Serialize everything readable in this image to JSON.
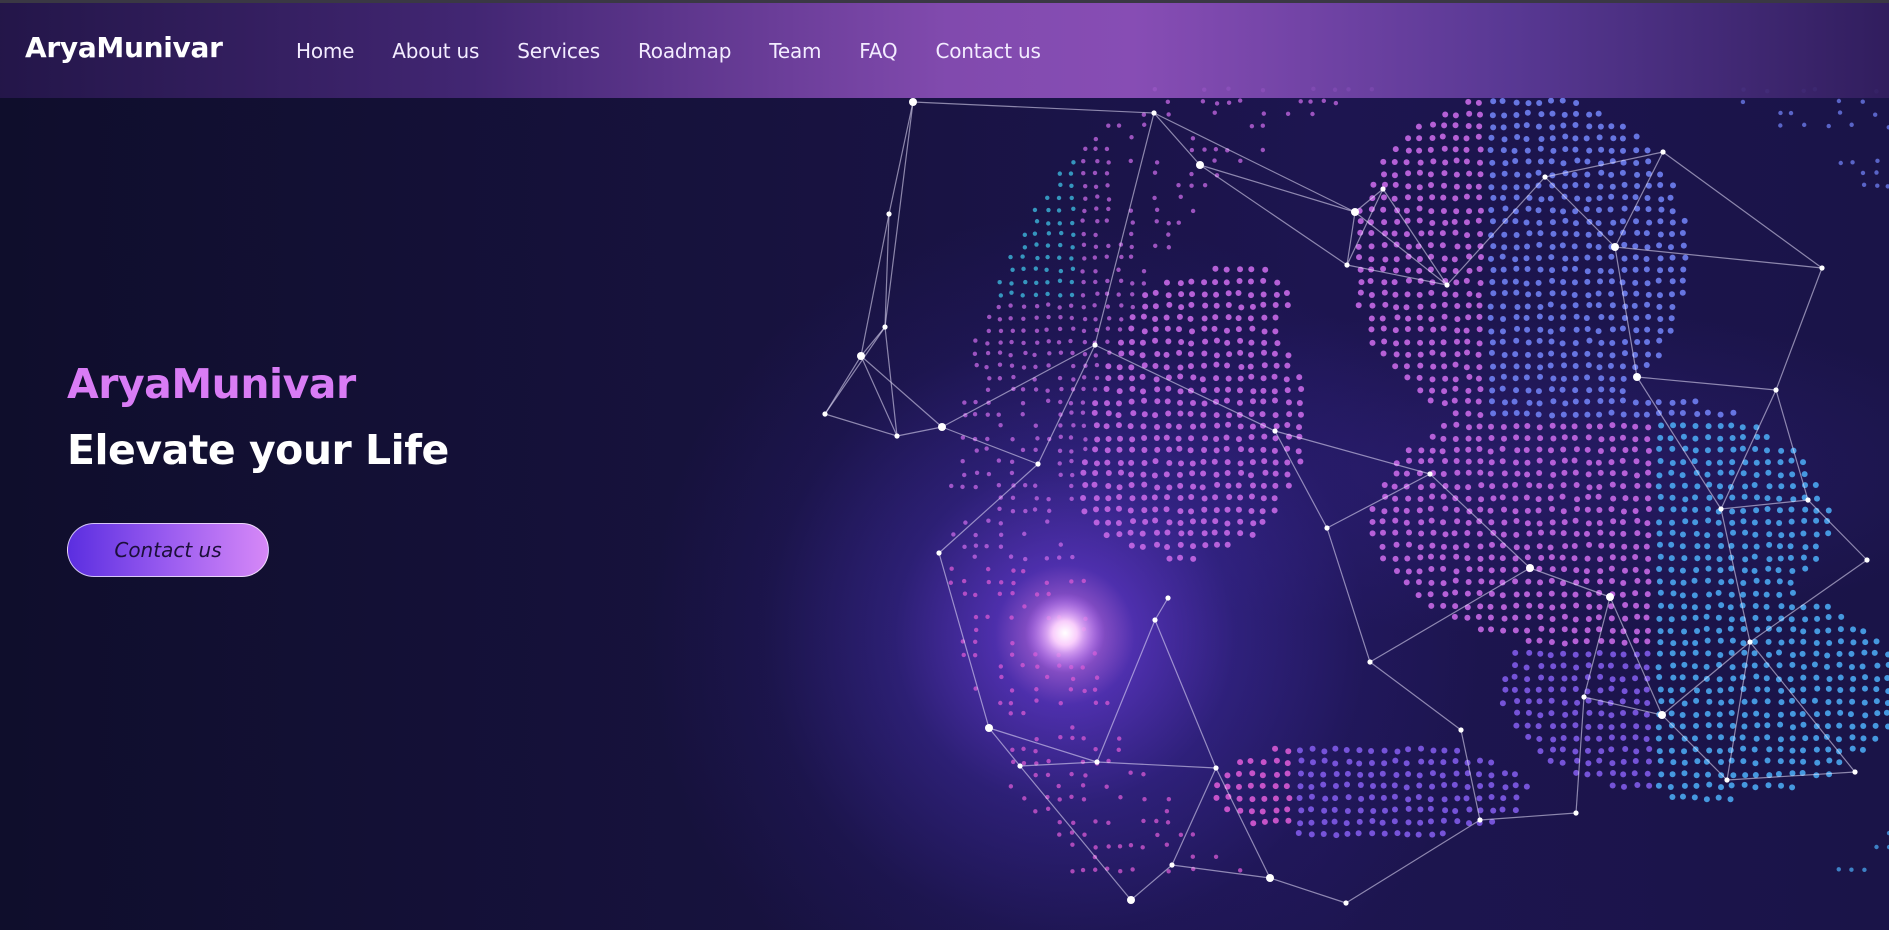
{
  "header": {
    "brand": "AryaMunivar",
    "nav": [
      "Home",
      "About us",
      "Services",
      "Roadmap",
      "Team",
      "FAQ",
      "Contact us"
    ]
  },
  "hero": {
    "title": "AryaMunivar",
    "subtitle": "Elevate your Life",
    "cta_label": "Contact us",
    "image": "digital-globe-network-icon"
  },
  "colors": {
    "accent": "#d97cf5",
    "button_start": "#5b2ee0",
    "button_end": "#d688f7",
    "background": "#14103a"
  }
}
